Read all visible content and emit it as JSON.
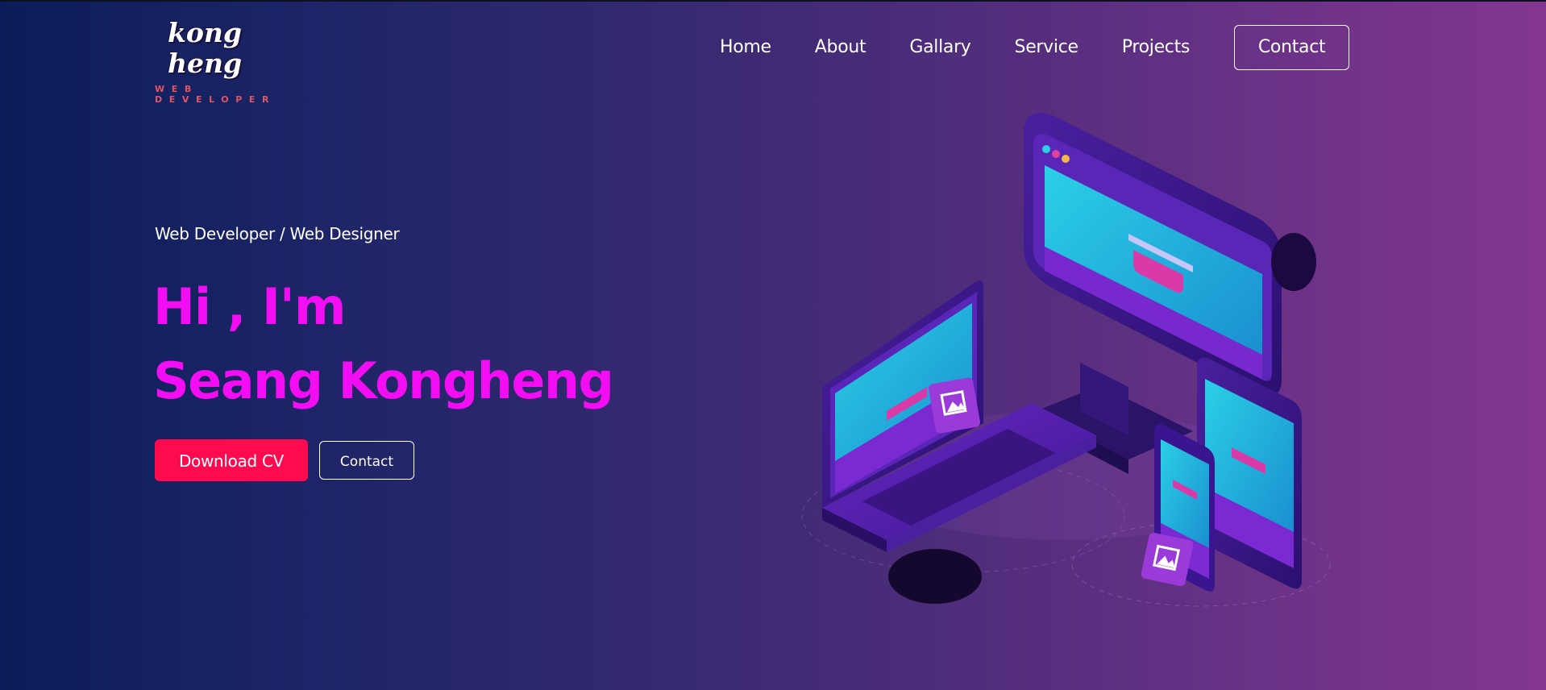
{
  "brand": {
    "name": "kong heng",
    "tagline": "WEB DEVELOPER"
  },
  "nav": {
    "items": [
      {
        "label": "Home"
      },
      {
        "label": "About"
      },
      {
        "label": "Gallary"
      },
      {
        "label": "Service"
      },
      {
        "label": "Projects"
      }
    ],
    "contact_label": "Contact"
  },
  "hero": {
    "role": "Web Developer / Web Designer",
    "greeting": "Hi , I'm",
    "name": "Seang Kongheng",
    "download_label": "Download CV",
    "contact_label": "Contact"
  },
  "colors": {
    "accent_magenta": "#f20df2",
    "button_red": "#ff0a4e",
    "tagline_red": "#e05560",
    "bg_left": "#0b1d58",
    "bg_right": "#83368f"
  },
  "icons": {
    "illustration": "devices-illustration",
    "image_placeholder": "image-icon"
  }
}
